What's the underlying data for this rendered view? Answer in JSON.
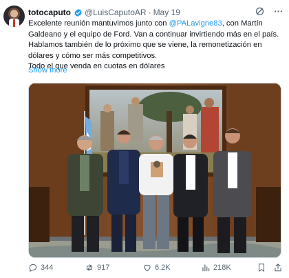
{
  "tweet": {
    "display_name": "totocaputo",
    "handle": "@LuisCaputoAR",
    "separator": "·",
    "date": "May 19",
    "text_lines": [
      {
        "before": "Excelente reunión mantuvimos junto con ",
        "mention": "@PALavigne83",
        "after": ", con Martín"
      },
      {
        "before": "Galdeano y el equipo de Ford. Van a continuar invirtiendo más en el país.",
        "mention": "",
        "after": ""
      },
      {
        "before": "Hablamos también de lo próximo que se viene, la remonetización en",
        "mention": "",
        "after": ""
      },
      {
        "before": "dólares y cómo ser más competitivos.",
        "mention": "",
        "after": ""
      },
      {
        "before": "Todo el que venda en cuotas en dólares",
        "mention": "",
        "after": ""
      }
    ],
    "show_more": "Show more"
  },
  "icons": {
    "verified": "verified-badge-icon",
    "grok": "grok-icon",
    "more": "more-icon",
    "reply": "reply-icon",
    "retweet": "retweet-icon",
    "like": "like-icon",
    "views": "views-icon",
    "bookmark": "bookmark-icon",
    "share": "share-icon"
  },
  "actions": {
    "replies": "344",
    "retweets": "917",
    "likes": "6.2K",
    "views": "218K"
  },
  "colors": {
    "accent": "#1d9bf0",
    "secondary_text": "#536471",
    "primary_text": "#0f1419"
  }
}
